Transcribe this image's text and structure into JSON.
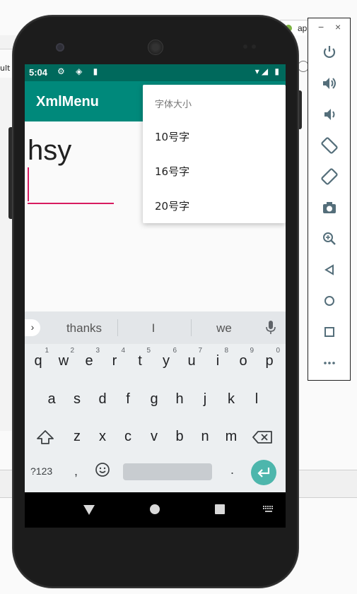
{
  "ide": {
    "left_text": "ult",
    "tab_label": "ap"
  },
  "status_bar": {
    "time": "5:04",
    "left_icons": "⚙ ◈ ▮",
    "right_icons": "▾◢ ▮"
  },
  "app_bar": {
    "title": "XmlMenu"
  },
  "content": {
    "text": "hsy"
  },
  "menu": {
    "header": "字体大小",
    "items": [
      {
        "label": "10号字"
      },
      {
        "label": "16号字"
      },
      {
        "label": "20号字"
      }
    ]
  },
  "keyboard": {
    "expand": "›",
    "suggestions": [
      "thanks",
      "I",
      "we"
    ],
    "row1": [
      {
        "key": "q",
        "num": "1"
      },
      {
        "key": "w",
        "num": "2"
      },
      {
        "key": "e",
        "num": "3"
      },
      {
        "key": "r",
        "num": "4"
      },
      {
        "key": "t",
        "num": "5"
      },
      {
        "key": "y",
        "num": "6"
      },
      {
        "key": "u",
        "num": "7"
      },
      {
        "key": "i",
        "num": "8"
      },
      {
        "key": "o",
        "num": "9"
      },
      {
        "key": "p",
        "num": "0"
      }
    ],
    "row2": [
      "a",
      "s",
      "d",
      "f",
      "g",
      "h",
      "j",
      "k",
      "l"
    ],
    "row3": [
      "z",
      "x",
      "c",
      "v",
      "b",
      "n",
      "m"
    ],
    "num_switch": "?123",
    "comma": ",",
    "period": "."
  },
  "emulator_toolbar": {
    "minimize": "−",
    "close": "×",
    "buttons": [
      "power-icon",
      "volume-up-icon",
      "volume-down-icon",
      "rotate-left-icon",
      "rotate-right-icon",
      "camera-icon",
      "zoom-icon",
      "back-icon",
      "home-icon",
      "overview-icon",
      "more-icon"
    ]
  },
  "colors": {
    "status_bar": "#00695c",
    "app_bar": "#00897b",
    "accent": "#d81b60",
    "enter_key": "#4db6ac"
  }
}
